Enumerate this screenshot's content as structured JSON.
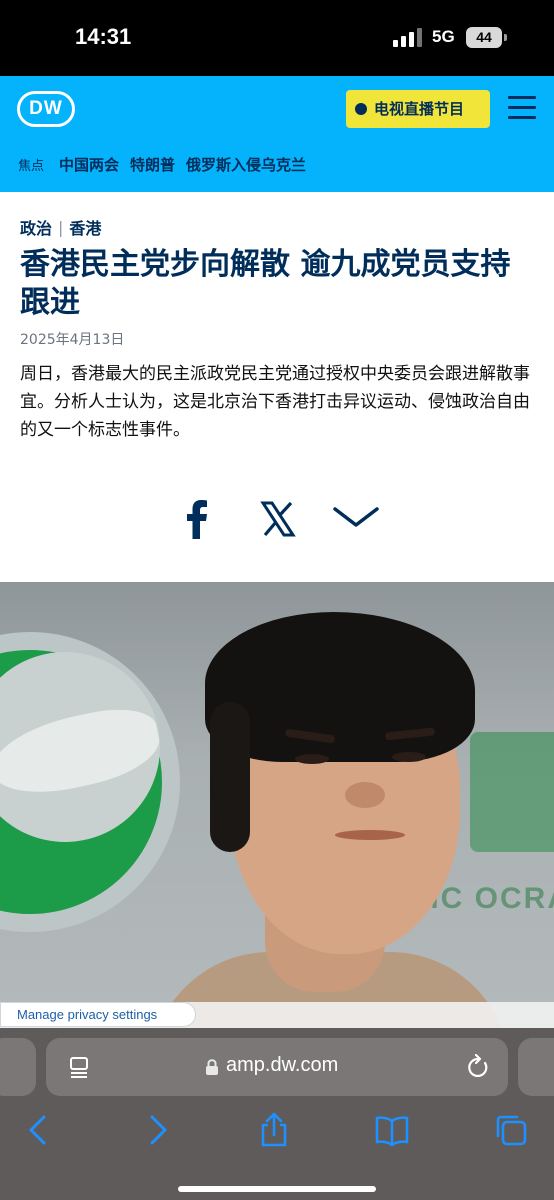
{
  "status_bar": {
    "time": "14:31",
    "network": "5G",
    "battery": "44"
  },
  "header": {
    "logo": "DW",
    "tv_button": "电视直播节目",
    "focus_label": "焦点",
    "focus_links": [
      "中国两会",
      "特朗普",
      "俄罗斯入侵乌克兰"
    ]
  },
  "article": {
    "kicker": [
      "政治",
      "香港"
    ],
    "headline": "香港民主党步向解散 逾九成党员支持跟进",
    "date": "2025年4月13日",
    "lead": "周日，香港最大的民主派政党民主党通过授权中央委员会跟进解散事宜。分析人士认为，这是北京治下香港打击异议运动、侵蚀政治自由的又一个标志性事件。"
  },
  "share": {
    "icons": [
      "facebook-icon",
      "x-icon",
      "chevron-down-icon"
    ]
  },
  "hero": {
    "background_text": "TIC  OCRA"
  },
  "privacy": {
    "label": "Manage privacy settings"
  },
  "browser": {
    "url": "amp.dw.com",
    "toolbar": [
      "back",
      "forward",
      "share",
      "bookmarks",
      "tabs"
    ]
  },
  "colors": {
    "dw_blue": "#05b2fc",
    "dw_navy": "#002d5a",
    "tv_yellow": "#f1e53a"
  }
}
